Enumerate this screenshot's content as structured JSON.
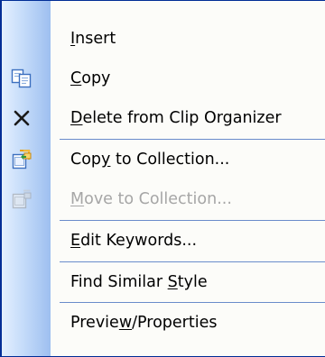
{
  "menu": {
    "items": [
      {
        "pre": "",
        "key": "I",
        "post": "nsert",
        "icon": "",
        "disabled": false
      },
      {
        "pre": "",
        "key": "C",
        "post": "opy",
        "icon": "copy-icon",
        "disabled": false
      },
      {
        "pre": "",
        "key": "D",
        "post": "elete from Clip Organizer",
        "icon": "delete-x-icon",
        "disabled": false
      },
      {
        "pre": "Cop",
        "key": "y",
        "post": " to Collection...",
        "icon": "copy-to-collection-icon",
        "disabled": false
      },
      {
        "pre": "",
        "key": "M",
        "post": "ove to Collection...",
        "icon": "move-to-collection-icon",
        "disabled": true
      },
      {
        "pre": "",
        "key": "E",
        "post": "dit Keywords...",
        "icon": "",
        "disabled": false
      },
      {
        "pre": "Find Similar ",
        "key": "S",
        "post": "tyle",
        "icon": "",
        "disabled": false
      },
      {
        "pre": "Previe",
        "key": "w",
        "post": "/Properties",
        "icon": "",
        "disabled": false
      }
    ]
  },
  "colors": {
    "border": "#002d96",
    "separator": "#6a8ccb",
    "disabled_text": "#a6a6a6",
    "gutter_light": "#e3efff",
    "gutter_dark": "#9ebff0"
  }
}
